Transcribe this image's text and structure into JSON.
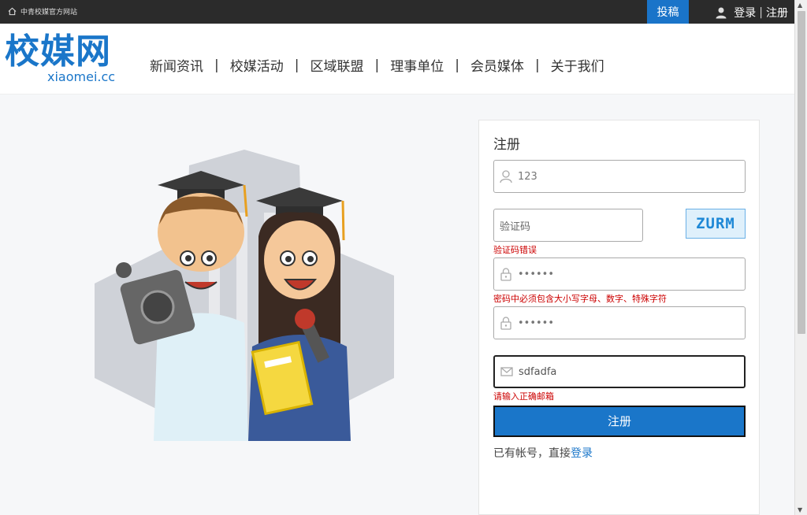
{
  "topbar": {
    "site_label": "中青校媒官方网站",
    "submit_tab": "投稿",
    "login": "登录",
    "separator": "|",
    "register": "注册"
  },
  "header": {
    "logo_cn": "校媒网",
    "logo_en": "xiaomei.cc",
    "nav": [
      {
        "label": "新闻资讯"
      },
      {
        "label": "校媒活动"
      },
      {
        "label": "区域联盟"
      },
      {
        "label": "理事单位"
      },
      {
        "label": "会员媒体"
      },
      {
        "label": "关于我们"
      }
    ],
    "nav_separator": "|"
  },
  "form": {
    "title": "注册",
    "username": {
      "value": "123"
    },
    "captcha": {
      "placeholder": "验证码",
      "image_text": "ZURM",
      "error": "验证码错误"
    },
    "password": {
      "value": "••••••",
      "error": "密码中必须包含大小写字母、数字、特殊字符"
    },
    "confirm_password": {
      "value": "••••••"
    },
    "email": {
      "value": "sdfadfa",
      "error": "请输入正确邮箱"
    },
    "submit_label": "注册",
    "has_account_text": "已有帐号，直接",
    "login_link": "登录"
  },
  "colors": {
    "brand": "#1a76c9",
    "error": "#cc0000",
    "topbar": "#2b2b2b"
  },
  "icons": [
    "home-icon",
    "user-icon",
    "lock-icon",
    "mail-icon"
  ]
}
